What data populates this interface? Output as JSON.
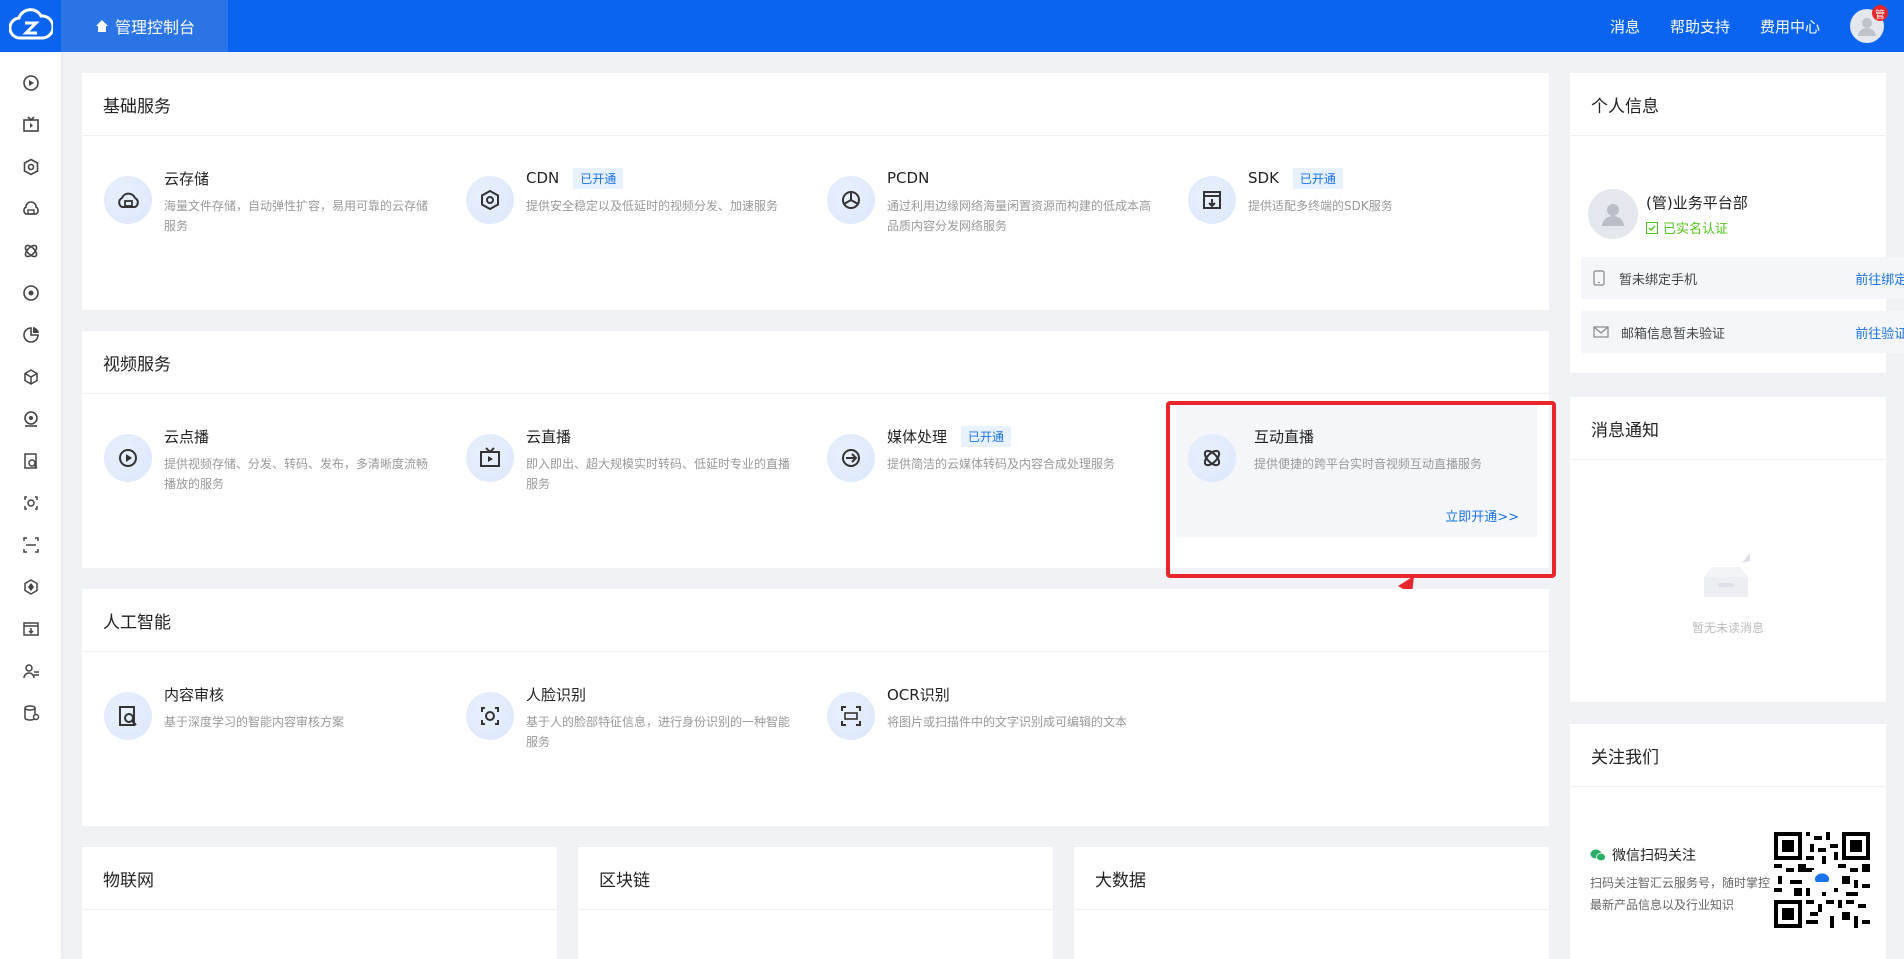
{
  "header": {
    "console_label": "管理控制台",
    "nav": [
      "消息",
      "帮助支持",
      "费用中心"
    ],
    "avatar_badge": "管"
  },
  "sidebar": {
    "icons": [
      "video-play-icon",
      "tv-icon",
      "hexagon-icon",
      "cloud-storage-icon",
      "interactive-icon",
      "media-icon",
      "pie-chart-icon",
      "cube-icon",
      "webcam-icon",
      "content-review-icon",
      "face-icon",
      "scan-icon",
      "network-icon",
      "box-icon",
      "user-list-icon",
      "database-icon"
    ]
  },
  "sections": {
    "basic": {
      "title": "基础服务",
      "items": [
        {
          "name": "云存储",
          "tag": "",
          "desc": "海量文件存储，自动弹性扩容，易用可靠的云存储服务"
        },
        {
          "name": "CDN",
          "tag": "已开通",
          "desc": "提供安全稳定以及低延时的视频分发、加速服务"
        },
        {
          "name": "PCDN",
          "tag": "",
          "desc": "通过利用边缘网络海量闲置资源而构建的低成本高品质内容分发网络服务"
        },
        {
          "name": "SDK",
          "tag": "已开通",
          "desc": "提供适配多终端的SDK服务"
        }
      ]
    },
    "video": {
      "title": "视频服务",
      "items": [
        {
          "name": "云点播",
          "tag": "",
          "desc": "提供视频存储、分发、转码、发布，多清晰度流畅播放的服务"
        },
        {
          "name": "云直播",
          "tag": "",
          "desc": "即入即出、超大规模实时转码、低延时专业的直播服务"
        },
        {
          "name": "媒体处理",
          "tag": "已开通",
          "desc": "提供简洁的云媒体转码及内容合成处理服务"
        },
        {
          "name": "互动直播",
          "tag": "",
          "desc": "提供便捷的跨平台实时音视频互动直播服务",
          "link": "立即开通>>"
        }
      ]
    },
    "ai": {
      "title": "人工智能",
      "items": [
        {
          "name": "内容审核",
          "tag": "",
          "desc": "基于深度学习的智能内容审核方案"
        },
        {
          "name": "人脸识别",
          "tag": "",
          "desc": "基于人的脸部特征信息，进行身份识别的一种智能服务"
        },
        {
          "name": "OCR识别",
          "tag": "",
          "desc": "将图片或扫描件中的文字识别成可编辑的文本"
        }
      ]
    },
    "bottom": [
      "物联网",
      "区块链",
      "大数据"
    ]
  },
  "profile": {
    "title": "个人信息",
    "name": "(管)业务平台部",
    "verified": "已实名认证",
    "phone_text": "暂未绑定手机",
    "phone_link": "前往绑定>>",
    "email_text": "邮箱信息暂未验证",
    "email_link": "前往验证>>"
  },
  "notice": {
    "title": "消息通知",
    "empty": "暂无未读消息"
  },
  "follow": {
    "title": "关注我们",
    "wechat": "微信扫码关注",
    "desc": "扫码关注智汇云服务号，随时掌控最新产品信息以及行业知识"
  },
  "colors": {
    "primary": "#0a64f0",
    "accent": "#1a73e8",
    "verified": "#52c41a",
    "highlight": "#e8262c"
  }
}
